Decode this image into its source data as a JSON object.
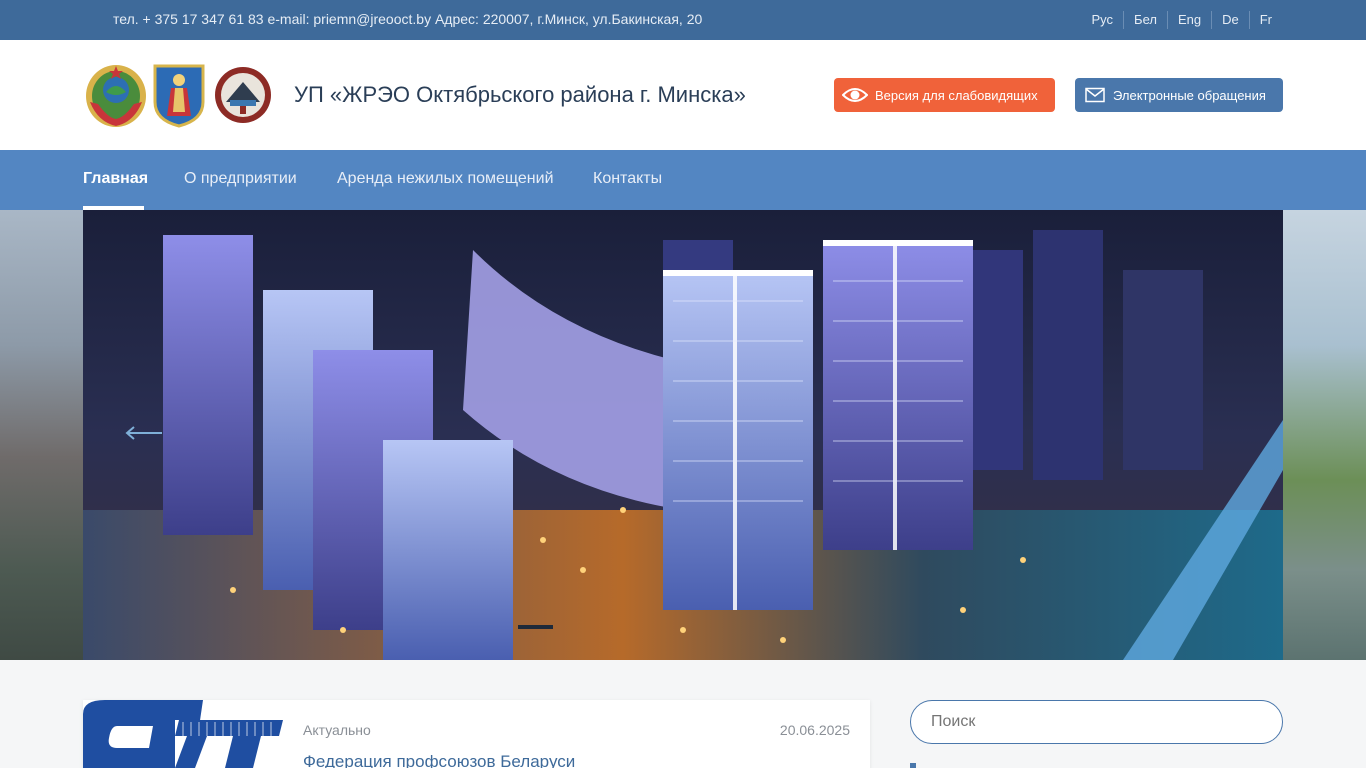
{
  "topbar": {
    "contacts": "тел. + 375 17 347 61 83 e-mail: priemn@jreooct.by Адрес: 220007, г.Минск, ул.Бакинская, 20",
    "languages": [
      "Рус",
      "Бел",
      "Eng",
      "De",
      "Fr"
    ]
  },
  "header": {
    "title": "УП «ЖРЭО Октябрьского района г. Минска»",
    "vision_button": "Версия для слабовидящих",
    "appeals_button": "Электронные обращения"
  },
  "nav": {
    "items": [
      "Главная",
      "О предприятии",
      "Аренда нежилых помещений",
      "Контакты"
    ],
    "active": "Главная"
  },
  "news": {
    "category": "Актуально",
    "date": "20.06.2025",
    "title": "Федерация профсоюзов Беларуси"
  },
  "search": {
    "placeholder": "Поиск"
  },
  "colors": {
    "topbar": "#3e6a9a",
    "nav": "#5386c2",
    "accent_orange": "#f0623a",
    "accent_blue": "#4a77ab"
  },
  "icons": [
    "eye-icon",
    "envelope-icon",
    "arrow-left-icon",
    "coat-of-arms-icon"
  ]
}
